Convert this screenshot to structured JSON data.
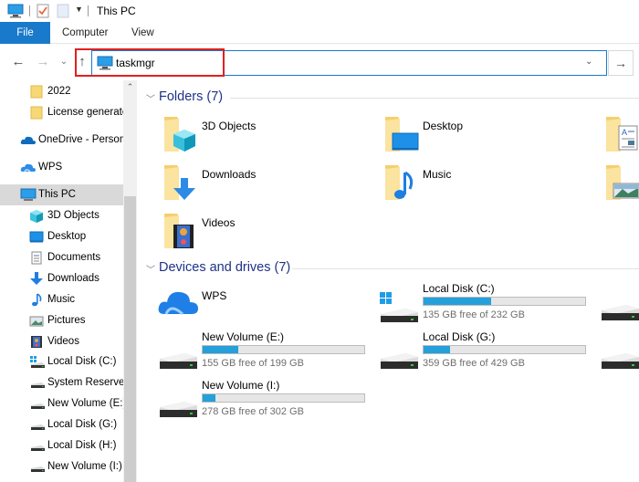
{
  "window": {
    "title": "This PC",
    "quick_access_icons": [
      "computer-icon",
      "properties-check-icon",
      "new-folder-icon",
      "customize-dropdown-icon"
    ]
  },
  "ribbon": {
    "tabs": [
      {
        "label": "File",
        "active": true
      },
      {
        "label": "Computer",
        "active": false
      },
      {
        "label": "View",
        "active": false
      }
    ]
  },
  "navigation": {
    "back_icon": "←",
    "forward_icon": "→",
    "recent_icon": "⌄",
    "up_icon": "↑",
    "address_value": "taskmgr",
    "go_icon": "→",
    "dropdown_icon": "⌄"
  },
  "sidebar": {
    "items": [
      {
        "label": "2022",
        "icon": "folder-icon",
        "level": 2
      },
      {
        "label": "License generate",
        "icon": "folder-icon",
        "level": 2
      },
      {
        "label": "OneDrive - Person",
        "icon": "onedrive-cloud-icon",
        "level": 1
      },
      {
        "label": "WPS",
        "icon": "wps-cloud-icon",
        "level": 1
      },
      {
        "label": "This PC",
        "icon": "this-pc-icon",
        "level": 1,
        "selected": true
      },
      {
        "label": "3D Objects",
        "icon": "3d-objects-icon",
        "level": 2
      },
      {
        "label": "Desktop",
        "icon": "desktop-icon",
        "level": 2
      },
      {
        "label": "Documents",
        "icon": "documents-icon",
        "level": 2
      },
      {
        "label": "Downloads",
        "icon": "downloads-icon",
        "level": 2
      },
      {
        "label": "Music",
        "icon": "music-icon",
        "level": 2
      },
      {
        "label": "Pictures",
        "icon": "pictures-icon",
        "level": 2
      },
      {
        "label": "Videos",
        "icon": "videos-icon",
        "level": 2
      },
      {
        "label": "Local Disk (C:)",
        "icon": "windows-drive-icon",
        "level": 2
      },
      {
        "label": "System Reserved",
        "icon": "drive-icon",
        "level": 2
      },
      {
        "label": "New Volume (E:)",
        "icon": "drive-icon",
        "level": 2
      },
      {
        "label": "Local Disk (G:)",
        "icon": "drive-icon",
        "level": 2
      },
      {
        "label": "Local Disk (H:)",
        "icon": "drive-icon",
        "level": 2
      },
      {
        "label": "New Volume (I:)",
        "icon": "drive-icon",
        "level": 2
      }
    ]
  },
  "main": {
    "folders_header": "Folders (7)",
    "folders": [
      {
        "label": "3D Objects",
        "icon": "3d-objects-folder-icon"
      },
      {
        "label": "Desktop",
        "icon": "desktop-folder-icon"
      },
      {
        "label": "",
        "icon": "documents-folder-icon"
      },
      {
        "label": "Downloads",
        "icon": "downloads-folder-icon"
      },
      {
        "label": "Music",
        "icon": "music-folder-icon"
      },
      {
        "label": "",
        "icon": "pictures-folder-icon"
      },
      {
        "label": "Videos",
        "icon": "videos-folder-icon"
      }
    ],
    "drives_header": "Devices and drives (7)",
    "drives": [
      {
        "label": "WPS",
        "icon": "wps-cloud-icon",
        "has_bar": false
      },
      {
        "label": "Local Disk (C:)",
        "icon": "windows-drive-icon",
        "has_bar": true,
        "free": "135 GB free of 232 GB",
        "used_fraction": 0.418
      },
      {
        "label": "",
        "icon": "drive-icon",
        "has_bar": false
      },
      {
        "label": "New Volume (E:)",
        "icon": "drive-icon",
        "has_bar": true,
        "free": "155 GB free of 199 GB",
        "used_fraction": 0.221
      },
      {
        "label": "Local Disk (G:)",
        "icon": "drive-icon",
        "has_bar": true,
        "free": "359 GB free of 429 GB",
        "used_fraction": 0.163
      },
      {
        "label": "",
        "icon": "drive-icon",
        "has_bar": false
      },
      {
        "label": "New Volume (I:)",
        "icon": "drive-icon",
        "has_bar": true,
        "free": "278 GB free of 302 GB",
        "used_fraction": 0.079
      }
    ]
  },
  "colors": {
    "accent": "#1979ca",
    "highlight_box": "#e02020",
    "group_header": "#1e3287",
    "drive_bar_fill": "#26a0da"
  }
}
